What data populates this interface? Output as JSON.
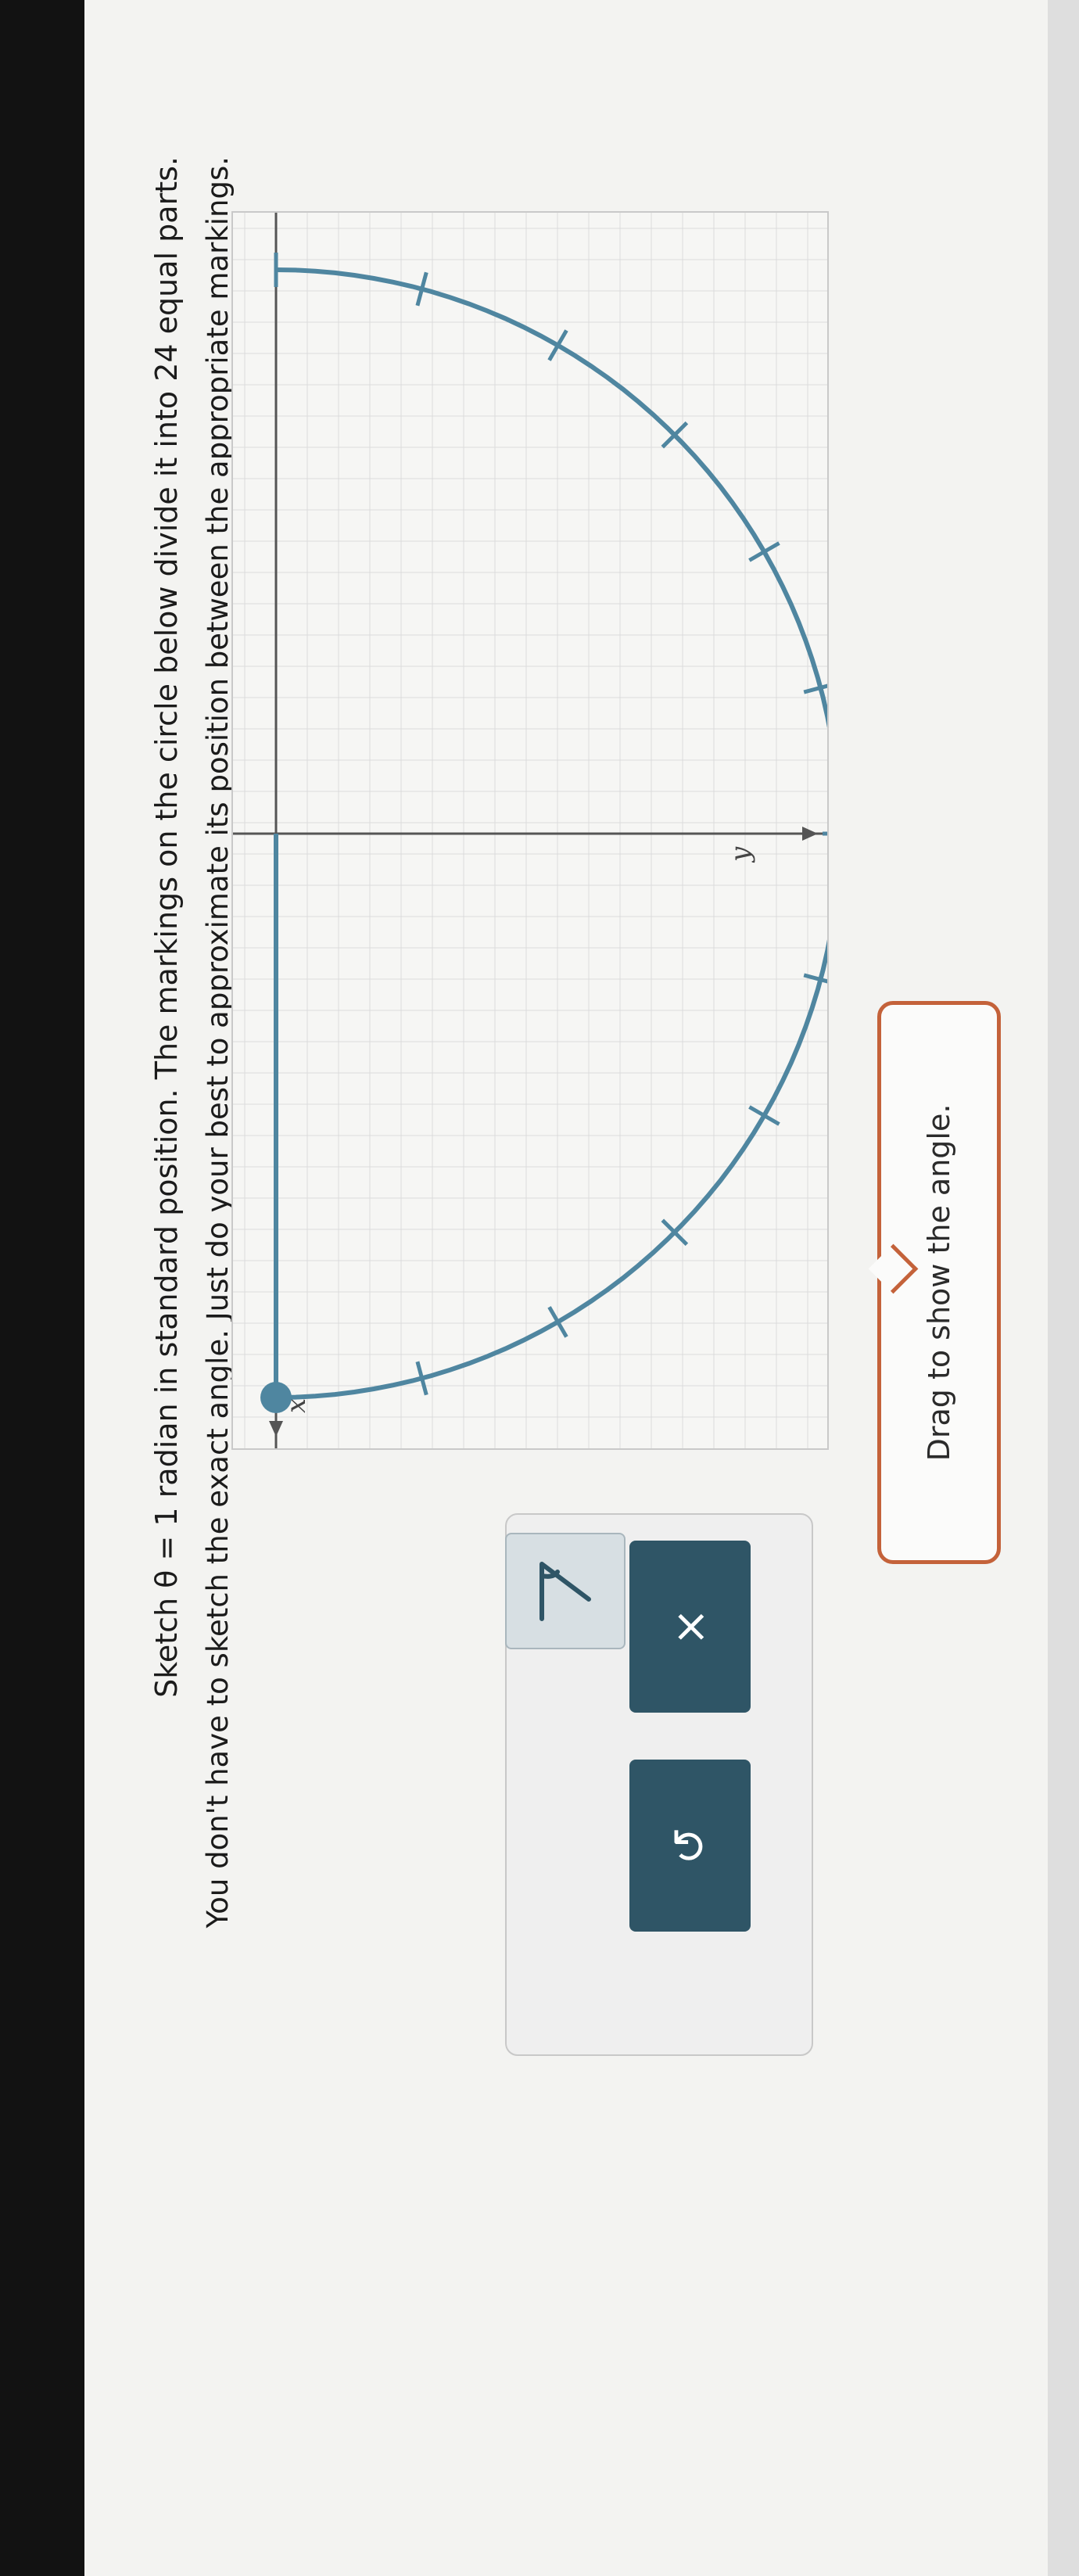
{
  "question": {
    "line1": "Sketch θ = 1 radian in standard position. The markings on the circle below divide it into 24 equal parts.",
    "line2": "You don't have to sketch the exact angle. Just do your best to approximate its position between the appropriate markings."
  },
  "graph": {
    "x_axis_label": "x",
    "y_axis_label": "y",
    "circle_divisions": 24
  },
  "tooltip": {
    "text": "Drag to show the angle."
  },
  "toolbar": {
    "angle_tool_icon": "angle-icon",
    "clear_button_glyph": "×",
    "undo_button_glyph": "↺"
  },
  "colors": {
    "circle": "#4f86a0",
    "accent": "#2f5566",
    "tooltip_border": "#c4623a"
  }
}
